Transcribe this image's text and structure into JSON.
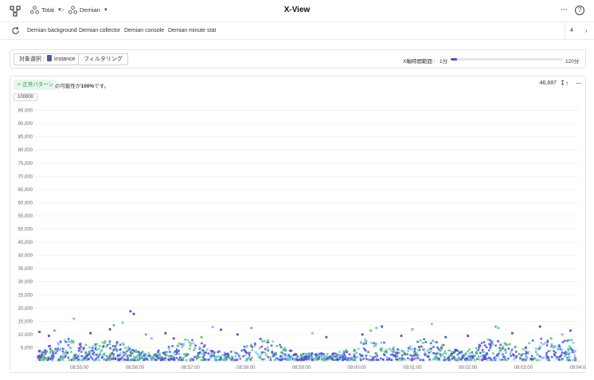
{
  "header": {
    "title": "X-View",
    "breadcrumb": [
      {
        "label": "Total",
        "icon": "cluster-icon"
      },
      {
        "label": "Demian",
        "icon": "cluster-icon"
      }
    ],
    "separator": ">",
    "more_glyph": "···",
    "help_glyph": "?"
  },
  "tabs": {
    "items": [
      "Demian background",
      "Demian collector",
      "Demian console",
      "Demian minute stat"
    ],
    "count": "4"
  },
  "filter": {
    "target_label": "対象選択 :",
    "target_value": "Instance",
    "filtering_label": "フィルタリング",
    "range_label": "X軸時間範囲 :",
    "range_min": "1分",
    "range_max": "120分",
    "range_value_fraction": 0.06
  },
  "panel": {
    "pattern_badge": "正常パターン",
    "pattern_text_prefix": "の可能性が",
    "pattern_percent": "100%",
    "pattern_text_suffix": "です。",
    "count": "46,687",
    "sort_glyph": "↧↑",
    "more_glyph": "···",
    "y_max_badge": "100000"
  },
  "colors": {
    "accent": "#5b46e0",
    "series_blue": "#3b5bdb",
    "series_purple": "#6741d9",
    "series_green": "#51cf66",
    "series_lightblue": "#74c0fc",
    "badge_green": "#2a9b4e"
  },
  "chart_data": {
    "type": "scatter",
    "title": "",
    "xlabel": "",
    "ylabel": "",
    "ylim": [
      0,
      100000
    ],
    "yticks": [
      "5,000",
      "10,000",
      "15,000",
      "20,000",
      "25,000",
      "30,000",
      "35,000",
      "40,000",
      "45,000",
      "50,000",
      "55,000",
      "60,000",
      "65,000",
      "70,000",
      "75,000",
      "80,000",
      "85,000",
      "90,000",
      "95,000"
    ],
    "xticks": [
      "08:55:00",
      "08:56:00",
      "08:57:00",
      "08:58:00",
      "08:59:00",
      "09:00:00",
      "09:01:00",
      "09:02:00",
      "09:03:00",
      "09:04:00"
    ],
    "x_range_minutes": [
      -0.8,
      9.0
    ],
    "grid": true,
    "outliers": [
      {
        "t": -0.72,
        "v": 11000
      },
      {
        "t": -0.55,
        "v": 9500
      },
      {
        "t": -0.45,
        "v": 11500
      },
      {
        "t": -0.1,
        "v": 16000
      },
      {
        "t": 0.2,
        "v": 10500
      },
      {
        "t": 0.55,
        "v": 12000
      },
      {
        "t": 0.62,
        "v": 13500
      },
      {
        "t": 0.78,
        "v": 14500
      },
      {
        "t": 0.92,
        "v": 18800
      },
      {
        "t": 0.98,
        "v": 17800
      },
      {
        "t": 1.2,
        "v": 10000
      },
      {
        "t": 1.3,
        "v": 8500
      },
      {
        "t": 1.55,
        "v": 10500
      },
      {
        "t": 1.7,
        "v": 8500
      },
      {
        "t": 2.2,
        "v": 9000
      },
      {
        "t": 2.4,
        "v": 12800
      },
      {
        "t": 2.55,
        "v": 11800
      },
      {
        "t": 2.85,
        "v": 10000
      },
      {
        "t": 3.1,
        "v": 12500
      },
      {
        "t": 4.2,
        "v": 10500
      },
      {
        "t": 4.45,
        "v": 9000
      },
      {
        "t": 5.1,
        "v": 10000
      },
      {
        "t": 5.25,
        "v": 11500
      },
      {
        "t": 5.35,
        "v": 12500
      },
      {
        "t": 5.45,
        "v": 13000
      },
      {
        "t": 5.8,
        "v": 9500
      },
      {
        "t": 6.0,
        "v": 12000
      },
      {
        "t": 6.35,
        "v": 14000
      },
      {
        "t": 6.6,
        "v": 9000
      },
      {
        "t": 7.0,
        "v": 9500
      },
      {
        "t": 7.5,
        "v": 13000
      },
      {
        "t": 7.55,
        "v": 12500
      },
      {
        "t": 7.8,
        "v": 10500
      },
      {
        "t": 8.3,
        "v": 13000
      },
      {
        "t": 8.5,
        "v": 8500
      },
      {
        "t": 8.7,
        "v": 10000
      },
      {
        "t": 8.85,
        "v": 11500
      }
    ]
  }
}
